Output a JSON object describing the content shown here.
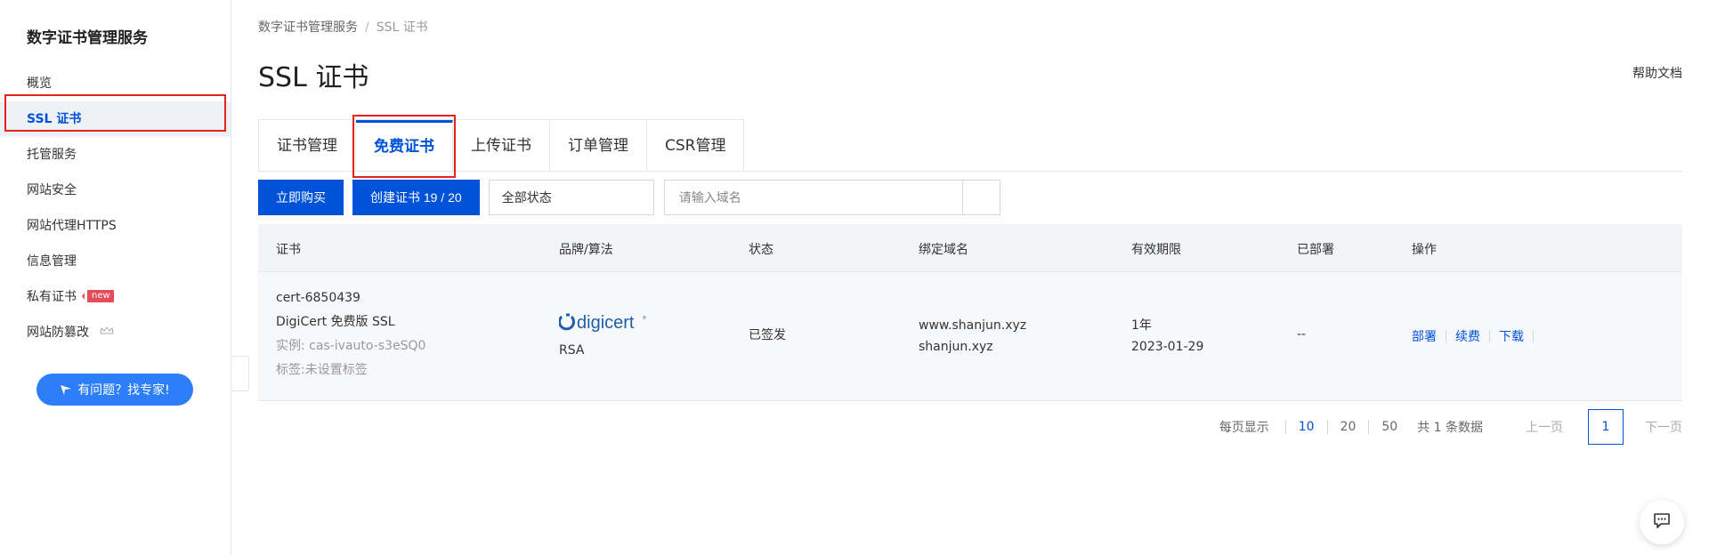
{
  "sidebar": {
    "title": "数字证书管理服务",
    "items": [
      {
        "label": "概览"
      },
      {
        "label": "SSL 证书"
      },
      {
        "label": "托管服务"
      },
      {
        "label": "网站安全"
      },
      {
        "label": "网站代理HTTPS"
      },
      {
        "label": "信息管理"
      },
      {
        "label": "私有证书",
        "badge": "new"
      },
      {
        "label": "网站防篡改"
      }
    ],
    "expert_button": "有问题？找专家!"
  },
  "breadcrumb": {
    "root": "数字证书管理服务",
    "current": "SSL 证书"
  },
  "page_title": "SSL 证书",
  "help_link": "帮助文档",
  "tabs": [
    {
      "label": "证书管理"
    },
    {
      "label": "免费证书"
    },
    {
      "label": "上传证书"
    },
    {
      "label": "订单管理"
    },
    {
      "label": "CSR管理"
    }
  ],
  "toolbar": {
    "buy_button": "立即购买",
    "create_button": "创建证书 19 / 20",
    "status_select": "全部状态",
    "search_placeholder": "请输入域名"
  },
  "table": {
    "headers": {
      "cert": "证书",
      "brand": "品牌/算法",
      "status": "状态",
      "domain": "绑定域名",
      "validity": "有效期限",
      "deployed": "已部署",
      "actions": "操作"
    },
    "row": {
      "cert_name": "cert-6850439",
      "cert_type": "DigiCert 免费版 SSL",
      "instance": "实例: cas-ivauto-s3eSQ0",
      "tags": "标签:未设置标签",
      "brand_logo": "digicert",
      "algorithm": "RSA",
      "status": "已签发",
      "domain1": "www.shanjun.xyz",
      "domain2": "shanjun.xyz",
      "validity_period": "1年",
      "validity_date": "2023-01-29",
      "deployed": "--",
      "action_deploy": "部署",
      "action_renew": "续费",
      "action_download": "下载"
    }
  },
  "pagination": {
    "page_size_label": "每页显示",
    "sizes": [
      "10",
      "20",
      "50"
    ],
    "total": "共 1 条数据",
    "prev": "上一页",
    "page": "1",
    "next": "下一页"
  },
  "colors": {
    "primary": "#0052d9",
    "highlight": "#e1251b",
    "badge": "#e34d59"
  }
}
